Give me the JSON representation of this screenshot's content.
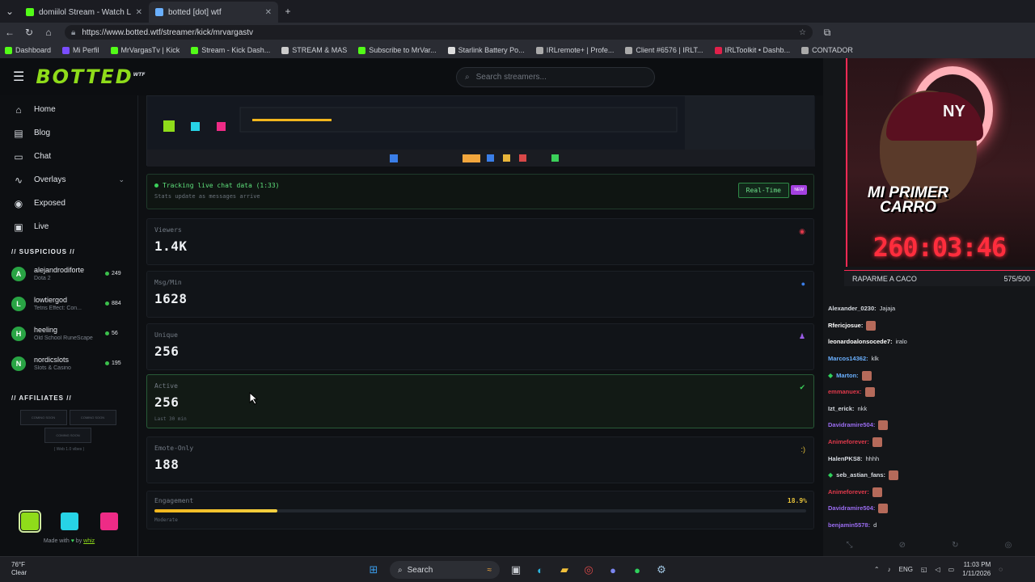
{
  "browser": {
    "tabs": [
      {
        "title": "domiilol Stream - Watch Live on K",
        "color": "#53fc18"
      },
      {
        "title": "botted [dot] wtf",
        "color": "#6ab0ff"
      }
    ],
    "url": "https://www.botted.wtf/streamer/kick/mrvargastv",
    "bookmarks": [
      {
        "label": "Dashboard",
        "color": "#53fc18"
      },
      {
        "label": "Mi Perfil",
        "color": "#7a4dff"
      },
      {
        "label": "MrVargasTv | Kick",
        "color": "#53fc18"
      },
      {
        "label": "Stream - Kick Dash...",
        "color": "#53fc18"
      },
      {
        "label": "STREAM & MAS",
        "color": "#cccccc"
      },
      {
        "label": "Subscribe to MrVar...",
        "color": "#53fc18"
      },
      {
        "label": "Starlink Battery Po...",
        "color": "#dddddd"
      },
      {
        "label": "IRLremote+ | Profe...",
        "color": "#aaaaaa"
      },
      {
        "label": "Client #6576 | IRLT...",
        "color": "#aaaaaa"
      },
      {
        "label": "IRLToolkit • Dashb...",
        "color": "#e0204a"
      },
      {
        "label": "CONTADOR",
        "color": "#aaaaaa"
      }
    ]
  },
  "site": {
    "logo": "BOTTED",
    "logo_sup": "WTF",
    "search_placeholder": "Search streamers..."
  },
  "sidebar": {
    "nav": [
      {
        "label": "Home",
        "icon": "home-icon",
        "glyph": "⌂"
      },
      {
        "label": "Blog",
        "icon": "blog-icon",
        "glyph": "▤"
      },
      {
        "label": "Chat",
        "icon": "chat-icon",
        "glyph": "▭"
      },
      {
        "label": "Overlays",
        "icon": "overlays-icon",
        "glyph": "∿"
      },
      {
        "label": "Exposed",
        "icon": "eye-icon",
        "glyph": "◉"
      },
      {
        "label": "Live",
        "icon": "tv-icon",
        "glyph": "▣"
      }
    ],
    "suspicious_title": "// SUSPICIOUS //",
    "suspicious": [
      {
        "initial": "A",
        "name": "alejandrodiforte",
        "game": "Dota 2",
        "count": "249"
      },
      {
        "initial": "L",
        "name": "lowtiergod",
        "game": "Tetris Effect: Con...",
        "count": "884"
      },
      {
        "initial": "H",
        "name": "heeling",
        "game": "Old School RuneScape",
        "count": "56"
      },
      {
        "initial": "N",
        "name": "nordicslots",
        "game": "Slots & Casino",
        "count": "195"
      }
    ],
    "affiliates_title": "// AFFILIATES //",
    "affiliates": [
      "COMING SOON",
      "COMING SOON",
      "COMING SOON"
    ],
    "affil_note": "( Web 1.0 vibes )",
    "swatches": [
      "#8fdc1a",
      "#27d3e6",
      "#ee2b86"
    ],
    "made_with": "Made with",
    "by": "by",
    "author": "whiz"
  },
  "main": {
    "tracking_label": "Tracking live chat data (1:33)",
    "tracking_sub": "Stats update as messages arrive",
    "realtime": "Real-Time",
    "new_badge": "NEW",
    "stats": [
      {
        "label": "Viewers",
        "value": "1.4K",
        "sub": "",
        "icon": "eye-icon",
        "glyph": "◉",
        "color": "#e0394b"
      },
      {
        "label": "Msg/Min",
        "value": "1628",
        "sub": "",
        "icon": "chat-bubble-icon",
        "glyph": "●",
        "color": "#3a7ee8"
      },
      {
        "label": "Unique",
        "value": "256",
        "sub": "",
        "icon": "users-icon",
        "glyph": "♟",
        "color": "#9a5ce6"
      },
      {
        "label": "Active",
        "value": "256",
        "sub": "Last 30 min",
        "icon": "check-icon",
        "glyph": "✔",
        "color": "#3bd05a"
      },
      {
        "label": "Emote-Only",
        "value": "188",
        "sub": "",
        "icon": "smiley-icon",
        "glyph": ":)",
        "color": "#e8c33a"
      }
    ],
    "engagement": {
      "label": "Engagement",
      "percent": "18.9%",
      "fraction": 0.189,
      "level": "Moderate"
    }
  },
  "overlay": {
    "banner": "MI PRIMER CARRO",
    "timer": "260:03:46",
    "goal_label": "RAPARME A CACO",
    "goal_count": "575/500",
    "chat": [
      {
        "user": "Alexander_0230:",
        "msg": "Jajaja",
        "color": "#d9dde3",
        "badge": false,
        "emote": false
      },
      {
        "user": "Rfericjosue:",
        "msg": "",
        "color": "#ffffff",
        "badge": false,
        "emote": true
      },
      {
        "user": "leonardoalonsocede7:",
        "msg": "iralo",
        "color": "#ffffff",
        "badge": false,
        "emote": false
      },
      {
        "user": "Marcos14362:",
        "msg": "klk",
        "color": "#6ab0ff",
        "badge": false,
        "emote": false
      },
      {
        "user": "Marton:",
        "msg": "",
        "color": "#6ab0ff",
        "badge": true,
        "emote": true
      },
      {
        "user": "emmanuex:",
        "msg": "",
        "color": "#e0394b",
        "badge": false,
        "emote": true
      },
      {
        "user": "Izt_erick:",
        "msg": "nkk",
        "color": "#d9dde3",
        "badge": false,
        "emote": false
      },
      {
        "user": "Davidramire504:",
        "msg": "",
        "color": "#9a6cf0",
        "badge": false,
        "emote": true
      },
      {
        "user": "Animeforever:",
        "msg": "",
        "color": "#e0394b",
        "badge": false,
        "emote": true
      },
      {
        "user": "HalenPKS8:",
        "msg": "hhhh",
        "color": "#d9dde3",
        "badge": false,
        "emote": false
      },
      {
        "user": "seb_astian_fans:",
        "msg": "",
        "color": "#d9dde3",
        "badge": true,
        "emote": true
      },
      {
        "user": "Animeforever:",
        "msg": "",
        "color": "#e0394b",
        "badge": false,
        "emote": true
      },
      {
        "user": "Davidramire504:",
        "msg": "",
        "color": "#9a6cf0",
        "badge": false,
        "emote": true
      },
      {
        "user": "benjamin5578:",
        "msg": "d",
        "color": "#9a6cf0",
        "badge": false,
        "emote": false
      }
    ]
  },
  "taskbar": {
    "temp": "76°F",
    "weather": "Clear",
    "search": "Search",
    "lang": "ENG",
    "time": "11:03 PM",
    "date": "1/11/2026"
  }
}
